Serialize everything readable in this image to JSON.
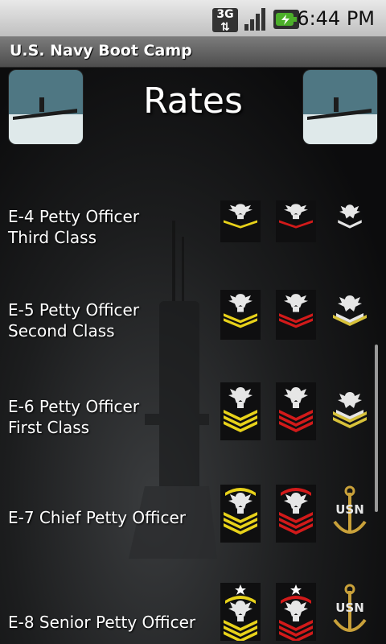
{
  "status_bar": {
    "time": "6:44 PM",
    "network": "3G",
    "icons": [
      "3g-data-icon",
      "signal-bars-icon",
      "battery-charging-icon"
    ]
  },
  "app": {
    "title": "U.S. Navy Boot Camp"
  },
  "page": {
    "title": "Rates"
  },
  "colors": {
    "gold": "#e8d21a",
    "red": "#d21a1a",
    "silver": "#e6e6e6",
    "title_bar": "#5c5c5c",
    "status_bar": "#d2d2d2"
  },
  "ranks": [
    {
      "label": "E-4 Petty Officer\n     Third Class",
      "chevrons": 1,
      "type": "petty",
      "insignia": [
        "gold-stripes-icon",
        "red-stripes-icon",
        "collar-device-icon"
      ]
    },
    {
      "label": "E-5 Petty Officer\n     Second Class",
      "chevrons": 2,
      "type": "petty",
      "insignia": [
        "gold-stripes-icon",
        "red-stripes-icon",
        "collar-device-icon"
      ]
    },
    {
      "label": "E-6 Petty Officer\n     First Class",
      "chevrons": 3,
      "type": "petty",
      "insignia": [
        "gold-stripes-icon",
        "red-stripes-icon",
        "collar-device-icon"
      ]
    },
    {
      "label": "E-7 Chief Petty Officer",
      "chevrons": 3,
      "type": "chief",
      "insignia": [
        "gold-stripes-icon",
        "red-stripes-icon",
        "usn-anchor-icon"
      ]
    },
    {
      "label": "E-8 Senior Petty Officer",
      "chevrons": 3,
      "type": "senior",
      "insignia": [
        "gold-stripes-icon",
        "red-stripes-icon",
        "usn-anchor-icon"
      ]
    }
  ]
}
